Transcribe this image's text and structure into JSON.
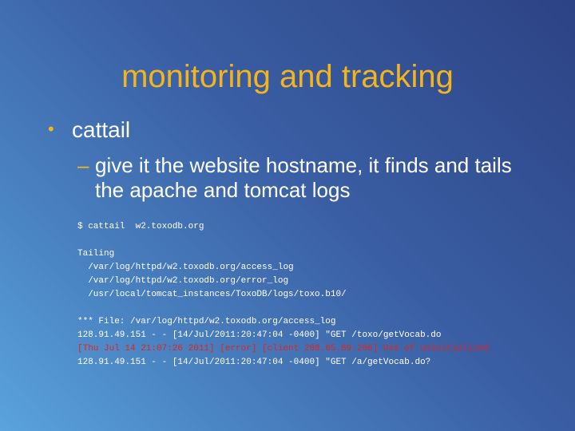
{
  "slide": {
    "title": "monitoring and tracking",
    "bullet": "cattail",
    "sub_bullet": "give it the website hostname, it finds and tails the apache and tomcat logs",
    "terminal_lines": [
      {
        "text": "$ cattail  w2.toxodb.org",
        "type": "normal"
      },
      {
        "text": "",
        "type": "normal"
      },
      {
        "text": "Tailing",
        "type": "normal"
      },
      {
        "text": "  /var/log/httpd/w2.toxodb.org/access_log",
        "type": "normal"
      },
      {
        "text": "  /var/log/httpd/w2.toxodb.org/error_log",
        "type": "normal"
      },
      {
        "text": "  /usr/local/tomcat_instances/ToxoDB/logs/toxo.b10/",
        "type": "normal"
      },
      {
        "text": "",
        "type": "normal"
      },
      {
        "text": "*** File: /var/log/httpd/w2.toxodb.org/access_log",
        "type": "normal"
      },
      {
        "text": "128.91.49.151 - - [14/Jul/2011:20:47:04 -0400] \"GET /toxo/getVocab.do",
        "type": "normal"
      },
      {
        "text": "[Thu Jul 14 21:07:26 2011] [error] [client 208.65.89.206] Use of uninitialized",
        "type": "error"
      },
      {
        "text": "128.91.49.151 - - [14/Jul/2011:20:47:04 -0400] \"GET /a/getVocab.do?",
        "type": "normal"
      }
    ]
  },
  "colors": {
    "title": "#f3b41c",
    "bullet_marker": "#f3b41c",
    "text": "#ffffff",
    "error_line": "#e8221c",
    "background_dark": "#2c4384",
    "background_light": "#5aa3dc"
  }
}
